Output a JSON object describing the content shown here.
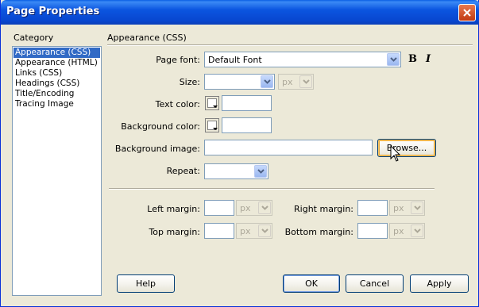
{
  "window": {
    "title": "Page Properties"
  },
  "category": {
    "label": "Category",
    "items": [
      "Appearance (CSS)",
      "Appearance (HTML)",
      "Links (CSS)",
      "Headings (CSS)",
      "Title/Encoding",
      "Tracing Image"
    ],
    "selected_index": 0
  },
  "panel": {
    "title": "Appearance (CSS)",
    "page_font": {
      "label": "Page font:",
      "value": "Default Font"
    },
    "bold_label": "B",
    "italic_label": "I",
    "size": {
      "label": "Size:",
      "value": "",
      "unit": "px"
    },
    "text_color": {
      "label": "Text color:",
      "value": ""
    },
    "background_color": {
      "label": "Background color:",
      "value": ""
    },
    "background_image": {
      "label": "Background image:",
      "value": "",
      "browse_label": "Browse..."
    },
    "repeat": {
      "label": "Repeat:",
      "value": ""
    },
    "left_margin": {
      "label": "Left margin:",
      "value": "",
      "unit": "px"
    },
    "right_margin": {
      "label": "Right margin:",
      "value": "",
      "unit": "px"
    },
    "top_margin": {
      "label": "Top margin:",
      "value": "",
      "unit": "px"
    },
    "bottom_margin": {
      "label": "Bottom margin:",
      "value": "",
      "unit": "px"
    }
  },
  "buttons": {
    "help": "Help",
    "ok": "OK",
    "cancel": "Cancel",
    "apply": "Apply"
  },
  "icons": {
    "close": "close-icon",
    "dropdown": "chevron-down-icon",
    "cursor": "mouse-pointer-icon"
  },
  "colors": {
    "titlebar": "#0b55e0",
    "selection": "#316ac5",
    "dialog_bg": "#ece9d8"
  }
}
